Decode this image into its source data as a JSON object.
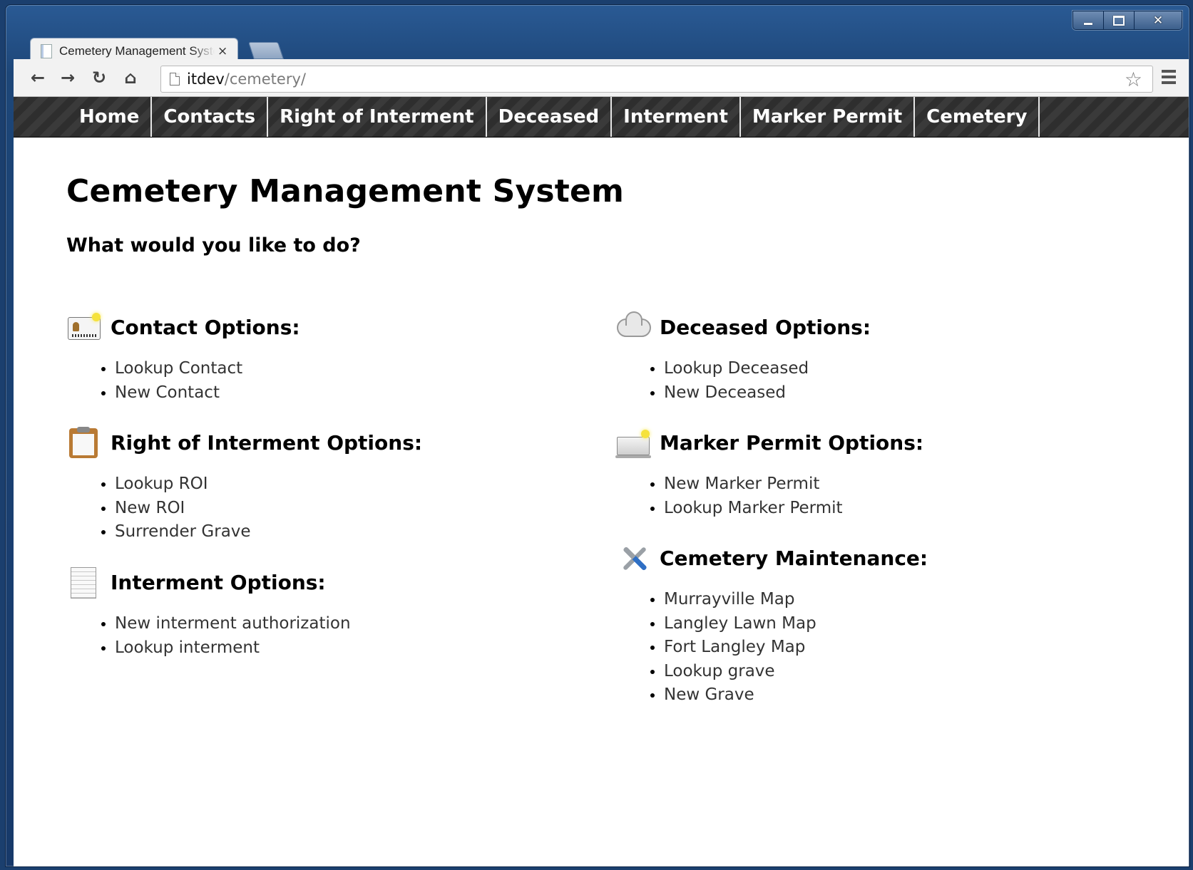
{
  "browser": {
    "tab_title": "Cemetery Management System",
    "tab_close": "×",
    "url_host": "itdev",
    "url_path": "/cemetery/"
  },
  "nav": {
    "items": [
      "Home",
      "Contacts",
      "Right of Interment",
      "Deceased",
      "Interment",
      "Marker Permit",
      "Cemetery"
    ]
  },
  "page": {
    "title": "Cemetery Management System",
    "prompt": "What would you like to do?"
  },
  "sections": {
    "contact": {
      "title": "Contact Options:",
      "icon": "contact-card-icon",
      "links": [
        "Lookup Contact",
        "New Contact"
      ]
    },
    "roi": {
      "title": "Right of Interment Options:",
      "icon": "clipboard-icon",
      "links": [
        "Lookup ROI",
        "New ROI",
        "Surrender Grave"
      ]
    },
    "interment": {
      "title": "Interment Options:",
      "icon": "document-icon",
      "links": [
        "New interment authorization",
        "Lookup interment"
      ]
    },
    "deceased": {
      "title": "Deceased Options:",
      "icon": "cloud-icon",
      "links": [
        "Lookup Deceased",
        "New Deceased"
      ]
    },
    "marker": {
      "title": "Marker Permit Options:",
      "icon": "laptop-icon",
      "links": [
        "New Marker Permit",
        "Lookup Marker Permit"
      ]
    },
    "maintenance": {
      "title": "Cemetery Maintenance:",
      "icon": "tools-icon",
      "links": [
        "Murrayville Map",
        "Langley Lawn Map",
        "Fort Langley Map",
        "Lookup grave",
        "New Grave"
      ]
    }
  }
}
